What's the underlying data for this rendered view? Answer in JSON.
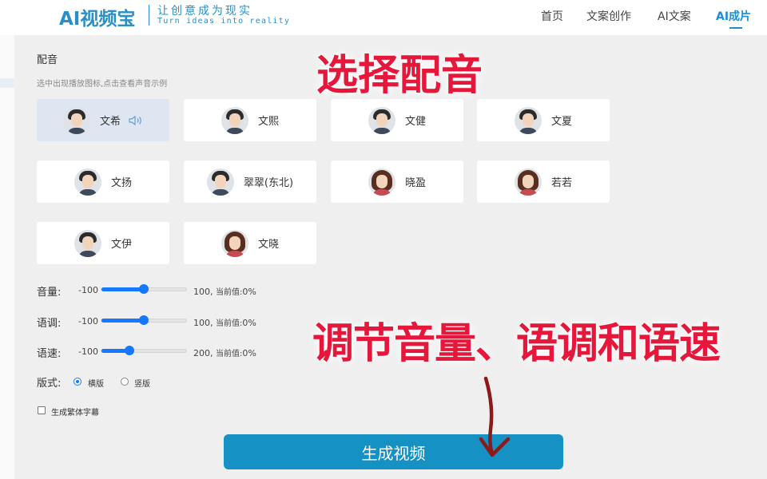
{
  "header": {
    "logo": "AI视频宝",
    "slogan": "让创意成为现实",
    "slogan_sub": "Turn ideas into reality",
    "nav": [
      "首页",
      "文案创作",
      "AI文案",
      "AI成片"
    ],
    "active_nav": "AI成片"
  },
  "voice_section": {
    "title": "配音",
    "hint": "选中出现播放图标,点击查看声音示例",
    "voices": [
      {
        "name": "文希",
        "gender": "male",
        "selected": true
      },
      {
        "name": "文熙",
        "gender": "male"
      },
      {
        "name": "文健",
        "gender": "male"
      },
      {
        "name": "文夏",
        "gender": "male"
      },
      {
        "name": "文扬",
        "gender": "male"
      },
      {
        "name": "翠翠(东北)",
        "gender": "male"
      },
      {
        "name": "晓盈",
        "gender": "female"
      },
      {
        "name": "若若",
        "gender": "female"
      },
      {
        "name": "文伊",
        "gender": "male"
      },
      {
        "name": "文晓",
        "gender": "female"
      }
    ]
  },
  "sliders": [
    {
      "label": "音量:",
      "min": "-100",
      "max": "100",
      "current_label": "当前值:",
      "current": "0%",
      "fraction": 0.5
    },
    {
      "label": "语调:",
      "min": "-100",
      "max": "100",
      "current_label": "当前值:",
      "current": "0%",
      "fraction": 0.5
    },
    {
      "label": "语速:",
      "min": "-100",
      "max": "200",
      "current_label": "当前值:",
      "current": "0%",
      "fraction": 0.333
    }
  ],
  "format": {
    "label": "版式:",
    "options": [
      "横版",
      "竖版"
    ],
    "selected": "横版"
  },
  "traditional_subtitle": {
    "label": "生成繁体字幕",
    "checked": false
  },
  "generate_button": "生成视频",
  "annotations": {
    "select_voice": "选择配音",
    "adjust": "调节音量、语调和语速"
  },
  "colors": {
    "brand": "#2a8fc4",
    "nav_active": "#1a8fd1",
    "slider": "#1677ff",
    "button": "#1591c4",
    "annotation": "#e5173a",
    "selected_card": "#dde6f1"
  }
}
